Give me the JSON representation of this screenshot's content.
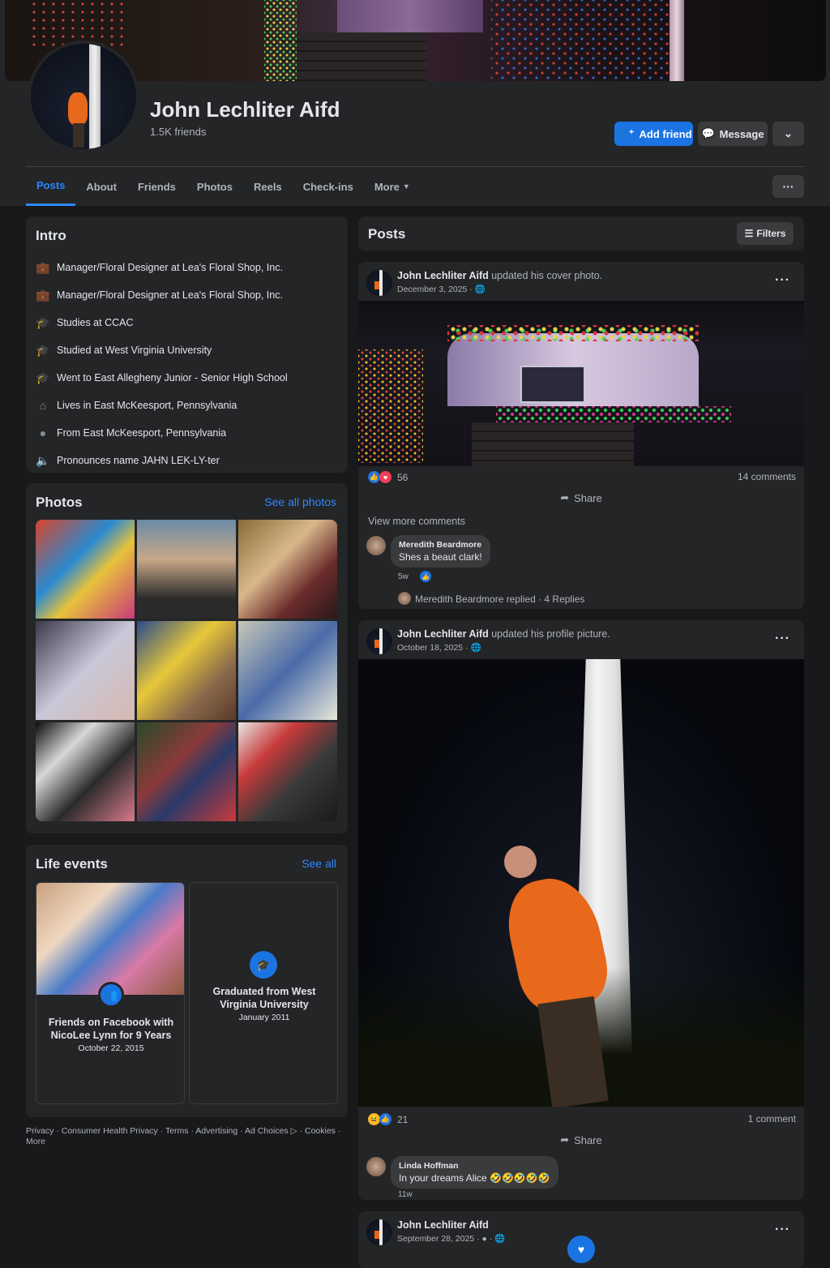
{
  "profile": {
    "name": "John Lechliter Aifd",
    "friends": "1.5K friends",
    "add_friend": "Add friend",
    "message": "Message"
  },
  "tabs": [
    "Posts",
    "About",
    "Friends",
    "Photos",
    "Reels",
    "Check-ins",
    "More"
  ],
  "intro": {
    "title": "Intro",
    "items": [
      {
        "icon": "briefcase-icon",
        "text": "Manager/Floral Designer at Lea's Floral Shop, Inc."
      },
      {
        "icon": "briefcase-icon",
        "text": "Manager/Floral Designer at Lea's Floral Shop, Inc."
      },
      {
        "icon": "graduation-cap-icon",
        "text": "Studies at CCAC"
      },
      {
        "icon": "graduation-cap-icon",
        "text": "Studied at West Virginia University"
      },
      {
        "icon": "graduation-cap-icon",
        "text": "Went to East Allegheny Junior - Senior High School"
      },
      {
        "icon": "home-icon",
        "text": "Lives in East McKeesport, Pennsylvania"
      },
      {
        "icon": "location-pin-icon",
        "text": "From East McKeesport, Pennsylvania"
      },
      {
        "icon": "speaker-icon",
        "text": "Pronounces name JAHN LEK-LY-ter"
      }
    ]
  },
  "photos": {
    "title": "Photos",
    "see_all": "See all photos"
  },
  "life_events": {
    "title": "Life events",
    "see_all": "See all",
    "events": [
      {
        "title": "Friends on Facebook with NicoLee Lynn for 9 Years",
        "date": "October 22, 2015"
      },
      {
        "title": "Graduated from West Virginia University",
        "date": "January 2011"
      }
    ]
  },
  "footer": "Privacy · Consumer Health Privacy · Terms · Advertising · Ad Choices ▷ · Cookies · More",
  "posts_header": {
    "title": "Posts",
    "filters": "Filters"
  },
  "posts": [
    {
      "author": "John Lechliter Aifd",
      "action": "updated his cover photo.",
      "date": "December 3, 2025 · ",
      "reactions": "56",
      "comments": "14 comments",
      "share": "Share",
      "view_more": "View more comments",
      "comment": {
        "author": "Meredith Beardmore",
        "text": "Shes a beaut clark!",
        "time": "5w"
      },
      "replies": "Meredith Beardmore replied · 4 Replies"
    },
    {
      "author": "John Lechliter Aifd",
      "action": "updated his profile picture.",
      "date": "October 18, 2025 · ",
      "reactions": "21",
      "comments": "1 comment",
      "share": "Share",
      "comment": {
        "author": "Linda Hoffman",
        "text": "In your dreams Alice 🤣🤣🤣🤣🤣",
        "time": "11w"
      }
    },
    {
      "author": "John Lechliter Aifd",
      "date": "September 28, 2025 · "
    }
  ],
  "colors": {
    "accent": "#1b74e4",
    "link": "#2d88ff",
    "background": "#18191a",
    "card": "#242526"
  }
}
